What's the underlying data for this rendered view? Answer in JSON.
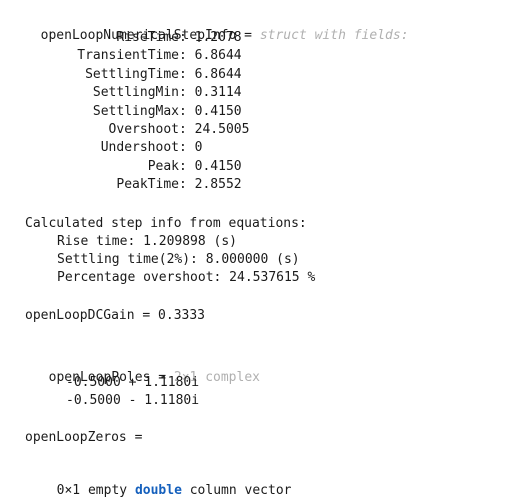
{
  "step_info": {
    "var_name": "openLoopNumericalStepInfo",
    "equals": " = ",
    "type_hint": "struct with fields:",
    "fields": [
      {
        "name": "RiseTime",
        "value": "1.2078"
      },
      {
        "name": "TransientTime",
        "value": "6.8644"
      },
      {
        "name": "SettlingTime",
        "value": "6.8644"
      },
      {
        "name": "SettlingMin",
        "value": "0.3114"
      },
      {
        "name": "SettlingMax",
        "value": "0.4150"
      },
      {
        "name": "Overshoot",
        "value": "24.5005"
      },
      {
        "name": "Undershoot",
        "value": "0"
      },
      {
        "name": "Peak",
        "value": "0.4150"
      },
      {
        "name": "PeakTime",
        "value": "2.8552"
      }
    ]
  },
  "calculated": {
    "heading": "Calculated step info from equations:",
    "rise": "Rise time: 1.209898 (s)",
    "settling": "Settling time(2%): 8.000000 (s)",
    "overshoot": "Percentage overshoot: 24.537615 %"
  },
  "dc_gain": {
    "text": "openLoopDCGain = 0.3333"
  },
  "poles": {
    "var_name": "openLoopPoles",
    "equals": " = ",
    "type_hint": "2×1 complex",
    "values": [
      "-0.5000 + 1.1180i",
      "-0.5000 - 1.1180i"
    ]
  },
  "zeros": {
    "text": "openLoopZeros =",
    "empty_prefix": "0×1 empty ",
    "empty_keyword": "double",
    "empty_suffix": " column vector"
  }
}
